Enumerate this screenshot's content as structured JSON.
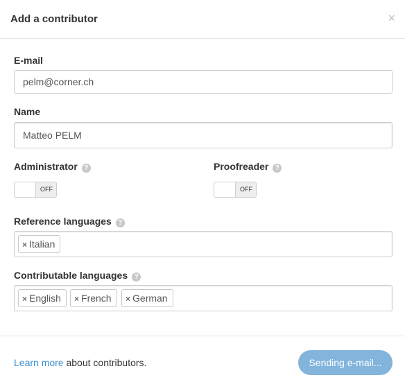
{
  "dialog": {
    "title": "Add a contributor",
    "close_glyph": "×"
  },
  "email": {
    "label": "E-mail",
    "value": "pelm@corner.ch"
  },
  "name": {
    "label": "Name",
    "value": "Matteo PELM"
  },
  "administrator": {
    "label": "Administrator",
    "toggle_text": "OFF",
    "state": "off"
  },
  "proofreader": {
    "label": "Proofreader",
    "toggle_text": "OFF",
    "state": "off"
  },
  "help_glyph": "?",
  "tag_remove_glyph": "×",
  "reference_languages": {
    "label": "Reference languages",
    "tags": [
      "Italian"
    ]
  },
  "contributable_languages": {
    "label": "Contributable languages",
    "tags": [
      "English",
      "French",
      "German"
    ]
  },
  "footer": {
    "learn_more_link": "Learn more",
    "learn_more_text": " about contributors.",
    "send_button": "Sending e-mail..."
  },
  "colors": {
    "link": "#3a8ed0",
    "primary_button": "#82b4dc"
  }
}
